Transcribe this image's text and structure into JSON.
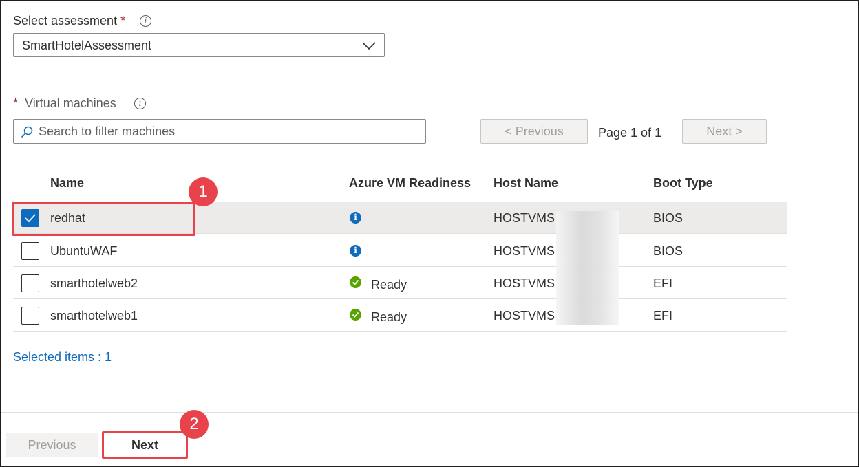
{
  "assessment": {
    "label": "Select assessment",
    "required_mark": "*",
    "info_icon": "info-icon",
    "selected_value": "SmartHotelAssessment"
  },
  "vms": {
    "required_mark": "*",
    "label": "Virtual machines",
    "info_icon": "info-icon",
    "search_placeholder": "Search to filter machines"
  },
  "pagination": {
    "prev_label": "< Previous",
    "page_text": "Page 1 of 1",
    "next_label": "Next >"
  },
  "table": {
    "headers": [
      "Name",
      "Azure VM Readiness",
      "Host Name",
      "Boot Type"
    ],
    "rows": [
      {
        "name": "redhat",
        "checked": true,
        "readiness_icon": "info-icon",
        "readiness": "",
        "host": "HOSTVMS",
        "boot": "BIOS"
      },
      {
        "name": "UbuntuWAF",
        "checked": false,
        "readiness_icon": "info-icon",
        "readiness": "",
        "host": "HOSTVMS",
        "boot": "BIOS"
      },
      {
        "name": "smarthotelweb2",
        "checked": false,
        "readiness_icon": "check-circle-icon",
        "readiness": "Ready",
        "host": "HOSTVMS",
        "boot": "EFI"
      },
      {
        "name": "smarthotelweb1",
        "checked": false,
        "readiness_icon": "check-circle-icon",
        "readiness": "Ready",
        "host": "HOSTVMS",
        "boot": "EFI"
      }
    ]
  },
  "selected_items": "Selected items : 1",
  "footer": {
    "previous_label": "Previous",
    "next_label": "Next"
  },
  "callouts": [
    "1",
    "2"
  ],
  "colors": {
    "accent": "#0f6cbd",
    "ready": "#57a300",
    "callout": "#e8434a",
    "required": "#a4262c"
  }
}
